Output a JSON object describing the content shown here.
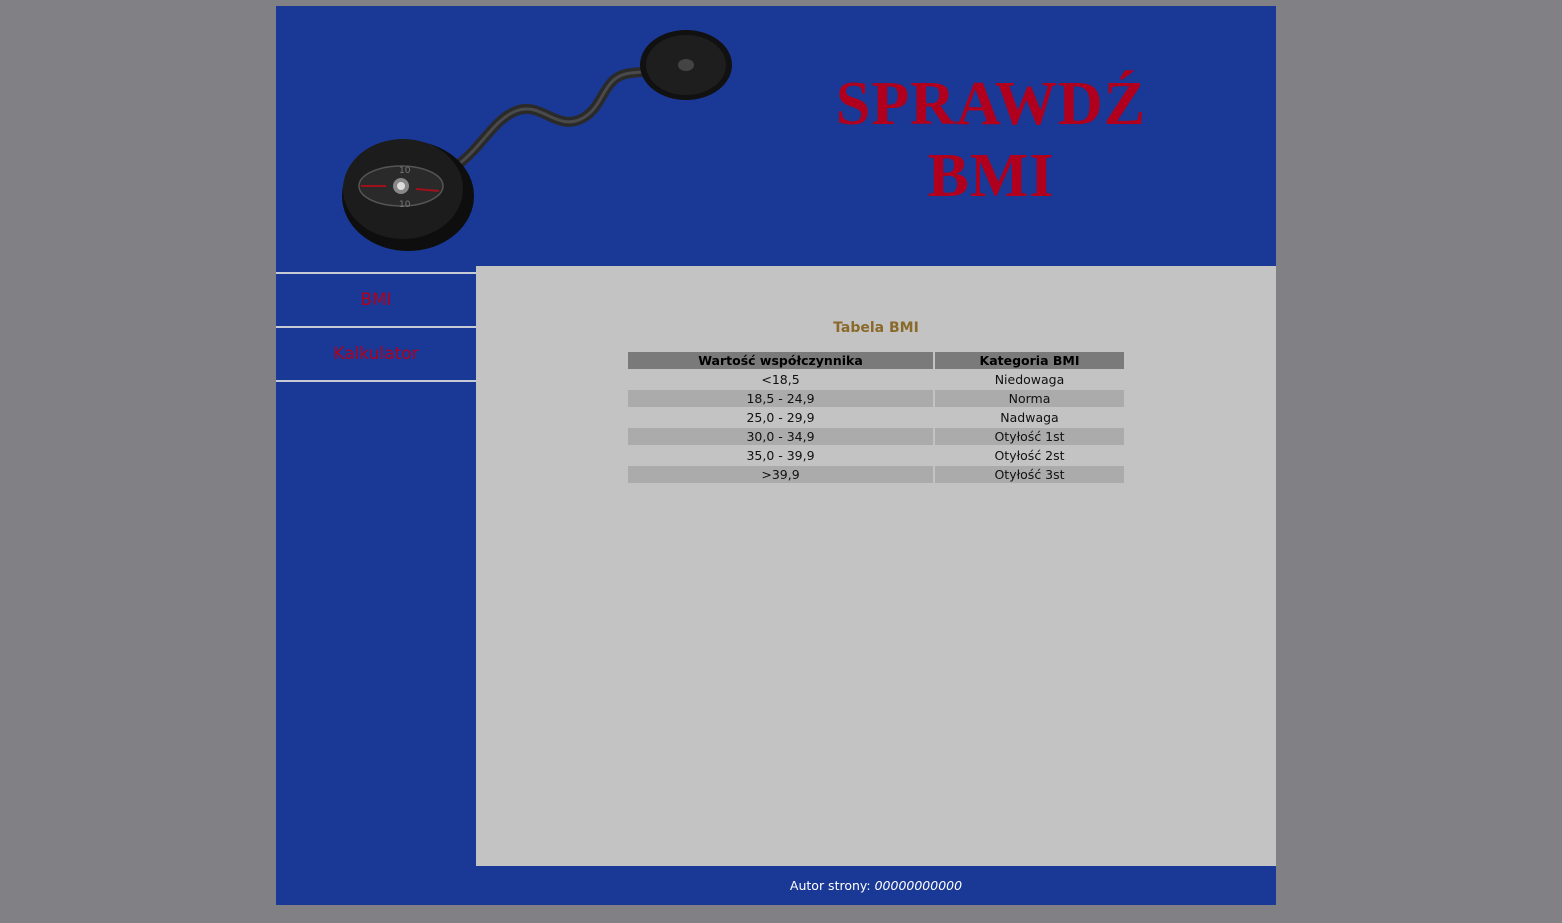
{
  "header": {
    "title_line1": "SPRAWDŹ",
    "title_line2": "BMI",
    "image_icon": "barbell-icon"
  },
  "menu": {
    "items": [
      {
        "label": "BMI"
      },
      {
        "label": "Kalkulator"
      }
    ]
  },
  "content": {
    "title": "Tabela BMI",
    "table": {
      "headers": [
        "Wartość współczynnika",
        "Kategoria BMI"
      ],
      "rows": [
        [
          "<18,5",
          "Niedowaga"
        ],
        [
          "18,5 - 24,9",
          "Norma"
        ],
        [
          "25,0 - 29,9",
          "Nadwaga"
        ],
        [
          "30,0 - 34,9",
          "Otyłość 1st"
        ],
        [
          "35,0 - 39,9",
          "Otyłość 2st"
        ],
        [
          ">39,9",
          "Otyłość 3st"
        ]
      ]
    }
  },
  "footer": {
    "label": "Autor strony:",
    "author": "00000000000"
  },
  "colors": {
    "outer_background": "#808085",
    "page_blue": "#1a3996",
    "content_gray": "#c3c3c3",
    "accent_red": "#b0001d",
    "title_gold": "#8a6a2a"
  }
}
